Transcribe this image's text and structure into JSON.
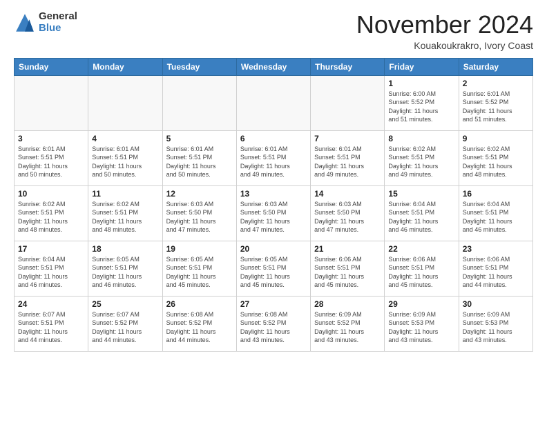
{
  "logo": {
    "general": "General",
    "blue": "Blue"
  },
  "header": {
    "title": "November 2024",
    "subtitle": "Kouakoukrakro, Ivory Coast"
  },
  "days_of_week": [
    "Sunday",
    "Monday",
    "Tuesday",
    "Wednesday",
    "Thursday",
    "Friday",
    "Saturday"
  ],
  "weeks": [
    [
      {
        "day": "",
        "info": ""
      },
      {
        "day": "",
        "info": ""
      },
      {
        "day": "",
        "info": ""
      },
      {
        "day": "",
        "info": ""
      },
      {
        "day": "",
        "info": ""
      },
      {
        "day": "1",
        "info": "Sunrise: 6:00 AM\nSunset: 5:52 PM\nDaylight: 11 hours\nand 51 minutes."
      },
      {
        "day": "2",
        "info": "Sunrise: 6:01 AM\nSunset: 5:52 PM\nDaylight: 11 hours\nand 51 minutes."
      }
    ],
    [
      {
        "day": "3",
        "info": "Sunrise: 6:01 AM\nSunset: 5:51 PM\nDaylight: 11 hours\nand 50 minutes."
      },
      {
        "day": "4",
        "info": "Sunrise: 6:01 AM\nSunset: 5:51 PM\nDaylight: 11 hours\nand 50 minutes."
      },
      {
        "day": "5",
        "info": "Sunrise: 6:01 AM\nSunset: 5:51 PM\nDaylight: 11 hours\nand 50 minutes."
      },
      {
        "day": "6",
        "info": "Sunrise: 6:01 AM\nSunset: 5:51 PM\nDaylight: 11 hours\nand 49 minutes."
      },
      {
        "day": "7",
        "info": "Sunrise: 6:01 AM\nSunset: 5:51 PM\nDaylight: 11 hours\nand 49 minutes."
      },
      {
        "day": "8",
        "info": "Sunrise: 6:02 AM\nSunset: 5:51 PM\nDaylight: 11 hours\nand 49 minutes."
      },
      {
        "day": "9",
        "info": "Sunrise: 6:02 AM\nSunset: 5:51 PM\nDaylight: 11 hours\nand 48 minutes."
      }
    ],
    [
      {
        "day": "10",
        "info": "Sunrise: 6:02 AM\nSunset: 5:51 PM\nDaylight: 11 hours\nand 48 minutes."
      },
      {
        "day": "11",
        "info": "Sunrise: 6:02 AM\nSunset: 5:51 PM\nDaylight: 11 hours\nand 48 minutes."
      },
      {
        "day": "12",
        "info": "Sunrise: 6:03 AM\nSunset: 5:50 PM\nDaylight: 11 hours\nand 47 minutes."
      },
      {
        "day": "13",
        "info": "Sunrise: 6:03 AM\nSunset: 5:50 PM\nDaylight: 11 hours\nand 47 minutes."
      },
      {
        "day": "14",
        "info": "Sunrise: 6:03 AM\nSunset: 5:50 PM\nDaylight: 11 hours\nand 47 minutes."
      },
      {
        "day": "15",
        "info": "Sunrise: 6:04 AM\nSunset: 5:51 PM\nDaylight: 11 hours\nand 46 minutes."
      },
      {
        "day": "16",
        "info": "Sunrise: 6:04 AM\nSunset: 5:51 PM\nDaylight: 11 hours\nand 46 minutes."
      }
    ],
    [
      {
        "day": "17",
        "info": "Sunrise: 6:04 AM\nSunset: 5:51 PM\nDaylight: 11 hours\nand 46 minutes."
      },
      {
        "day": "18",
        "info": "Sunrise: 6:05 AM\nSunset: 5:51 PM\nDaylight: 11 hours\nand 46 minutes."
      },
      {
        "day": "19",
        "info": "Sunrise: 6:05 AM\nSunset: 5:51 PM\nDaylight: 11 hours\nand 45 minutes."
      },
      {
        "day": "20",
        "info": "Sunrise: 6:05 AM\nSunset: 5:51 PM\nDaylight: 11 hours\nand 45 minutes."
      },
      {
        "day": "21",
        "info": "Sunrise: 6:06 AM\nSunset: 5:51 PM\nDaylight: 11 hours\nand 45 minutes."
      },
      {
        "day": "22",
        "info": "Sunrise: 6:06 AM\nSunset: 5:51 PM\nDaylight: 11 hours\nand 45 minutes."
      },
      {
        "day": "23",
        "info": "Sunrise: 6:06 AM\nSunset: 5:51 PM\nDaylight: 11 hours\nand 44 minutes."
      }
    ],
    [
      {
        "day": "24",
        "info": "Sunrise: 6:07 AM\nSunset: 5:51 PM\nDaylight: 11 hours\nand 44 minutes."
      },
      {
        "day": "25",
        "info": "Sunrise: 6:07 AM\nSunset: 5:52 PM\nDaylight: 11 hours\nand 44 minutes."
      },
      {
        "day": "26",
        "info": "Sunrise: 6:08 AM\nSunset: 5:52 PM\nDaylight: 11 hours\nand 44 minutes."
      },
      {
        "day": "27",
        "info": "Sunrise: 6:08 AM\nSunset: 5:52 PM\nDaylight: 11 hours\nand 43 minutes."
      },
      {
        "day": "28",
        "info": "Sunrise: 6:09 AM\nSunset: 5:52 PM\nDaylight: 11 hours\nand 43 minutes."
      },
      {
        "day": "29",
        "info": "Sunrise: 6:09 AM\nSunset: 5:53 PM\nDaylight: 11 hours\nand 43 minutes."
      },
      {
        "day": "30",
        "info": "Sunrise: 6:09 AM\nSunset: 5:53 PM\nDaylight: 11 hours\nand 43 minutes."
      }
    ]
  ]
}
